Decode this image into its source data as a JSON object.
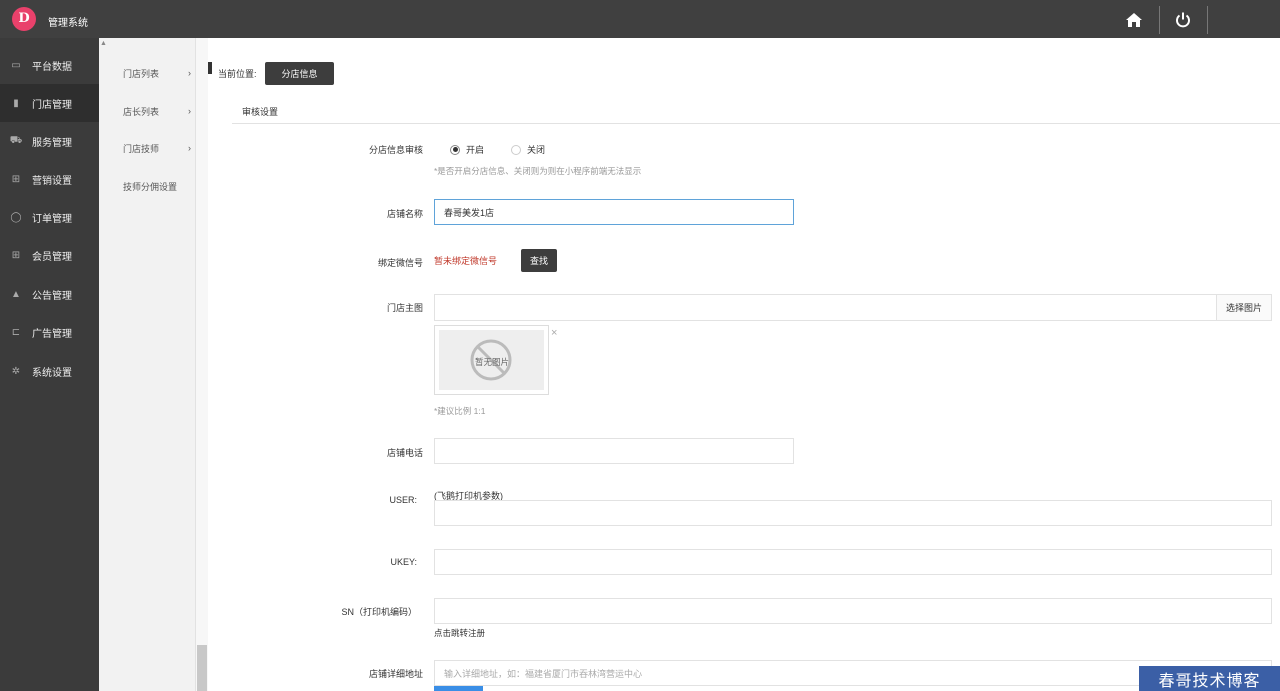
{
  "app": {
    "logo_char": "D",
    "title": "管理系统"
  },
  "topbar": {
    "icons": [
      "home-icon",
      "power-icon"
    ]
  },
  "sidebar": {
    "items": [
      {
        "label": "平台数据",
        "icon": "dashboard-icon",
        "glyph": "▭"
      },
      {
        "label": "门店管理",
        "icon": "store-icon",
        "glyph": "▮"
      },
      {
        "label": "服务管理",
        "icon": "car-icon",
        "glyph": "⛟"
      },
      {
        "label": "营销设置",
        "icon": "gift-icon",
        "glyph": "⊞"
      },
      {
        "label": "订单管理",
        "icon": "chat-icon",
        "glyph": "◯"
      },
      {
        "label": "会员管理",
        "icon": "gift-icon",
        "glyph": "⊞"
      },
      {
        "label": "公告管理",
        "icon": "bell-icon",
        "glyph": "▲"
      },
      {
        "label": "广告管理",
        "icon": "cart-icon",
        "glyph": "⊏"
      },
      {
        "label": "系统设置",
        "icon": "gear-icon",
        "glyph": "✲"
      }
    ],
    "active_index": 1
  },
  "submenu": {
    "items": [
      {
        "label": "门店列表",
        "arrow": "›"
      },
      {
        "label": "店长列表",
        "arrow": "›"
      },
      {
        "label": "门店技师",
        "arrow": "›"
      },
      {
        "label": "技师分佣设置",
        "arrow": ""
      }
    ]
  },
  "breadcrumb": {
    "label": "当前位置:",
    "current": "分店信息"
  },
  "panel": {
    "header": "审核设置"
  },
  "form": {
    "audit": {
      "label": "分店信息审核",
      "option_on": "开启",
      "option_off": "关闭",
      "hint": "*是否开启分店信息、关闭则为则在小程序前端无法显示"
    },
    "shop_name": {
      "label": "店铺名称",
      "value": "春哥美发1店"
    },
    "wechat": {
      "label": "绑定微信号",
      "status": "暂未绑定微信号",
      "button": "查找"
    },
    "main_image": {
      "label": "门店主图",
      "button": "选择图片",
      "no_image": "暂无图片",
      "remove": "×",
      "hint": "*建议比例 1:1"
    },
    "phone": {
      "label": "店铺电话",
      "value": ""
    },
    "user": {
      "label": "USER:",
      "note": "(飞鹅打印机参数)",
      "value": ""
    },
    "ukey": {
      "label": "UKEY:",
      "value": ""
    },
    "sn": {
      "label": "SN（打印机编码）",
      "value": "",
      "link": "点击跳转注册"
    },
    "address": {
      "label": "店铺详细地址",
      "placeholder": "输入详细地址，如：福建省厦门市吞林湾营运中心"
    }
  },
  "watermark": "春哥技术博客"
}
